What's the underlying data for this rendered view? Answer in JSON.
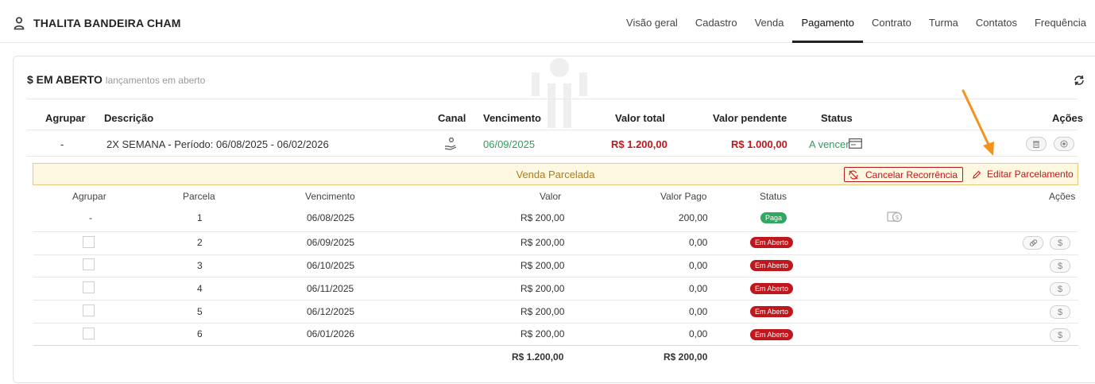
{
  "student": {
    "name": "THALITA BANDEIRA CHAM"
  },
  "tabs": [
    {
      "label": "Visão geral"
    },
    {
      "label": "Cadastro"
    },
    {
      "label": "Venda"
    },
    {
      "label": "Pagamento"
    },
    {
      "label": "Contrato"
    },
    {
      "label": "Turma"
    },
    {
      "label": "Contatos"
    },
    {
      "label": "Frequência"
    }
  ],
  "card": {
    "title": "$ EM ABERTO",
    "subtitle": "lançamentos em aberto"
  },
  "table": {
    "headers": {
      "agrupar": "Agrupar",
      "descricao": "Descrição",
      "canal": "Canal",
      "vencimento": "Vencimento",
      "valor_total": "Valor total",
      "valor_pendente": "Valor pendente",
      "status": "Status",
      "acoes": "Ações"
    },
    "row": {
      "agrupar": "-",
      "descricao": "2X SEMANA - Período: 06/08/2025 - 06/02/2026",
      "vencimento": "06/09/2025",
      "valor_total": "R$ 1.200,00",
      "valor_pendente": "R$ 1.000,00",
      "status": "A vencer"
    }
  },
  "parcelado": {
    "label": "Venda Parcelada",
    "cancel_label": "Cancelar Recorrência",
    "edit_label": "Editar Parcelamento"
  },
  "subtable": {
    "headers": {
      "agrupar": "Agrupar",
      "parcela": "Parcela",
      "vencimento": "Vencimento",
      "valor": "Valor",
      "valor_pago": "Valor Pago",
      "status": "Status",
      "acoes": "Ações"
    },
    "rows": [
      {
        "agrupar": "-",
        "parcela": "1",
        "vencimento": "06/08/2025",
        "valor": "R$ 200,00",
        "valor_pago": "200,00",
        "status": "Paga"
      },
      {
        "parcela": "2",
        "vencimento": "06/09/2025",
        "valor": "R$ 200,00",
        "valor_pago": "0,00",
        "status": "Em Aberto"
      },
      {
        "parcela": "3",
        "vencimento": "06/10/2025",
        "valor": "R$ 200,00",
        "valor_pago": "0,00",
        "status": "Em Aberto"
      },
      {
        "parcela": "4",
        "vencimento": "06/11/2025",
        "valor": "R$ 200,00",
        "valor_pago": "0,00",
        "status": "Em Aberto"
      },
      {
        "parcela": "5",
        "vencimento": "06/12/2025",
        "valor": "R$ 200,00",
        "valor_pago": "0,00",
        "status": "Em Aberto"
      },
      {
        "parcela": "6",
        "vencimento": "06/01/2026",
        "valor": "R$ 200,00",
        "valor_pago": "0,00",
        "status": "Em Aberto"
      }
    ],
    "totals": {
      "valor": "R$ 1.200,00",
      "valor_pago": "R$ 200,00"
    },
    "action_symbol": "$"
  },
  "colors": {
    "red": "#c0171c",
    "green": "#2eaa60",
    "accent_orange": "#f5921e",
    "bar_bg": "#fff8e1"
  }
}
